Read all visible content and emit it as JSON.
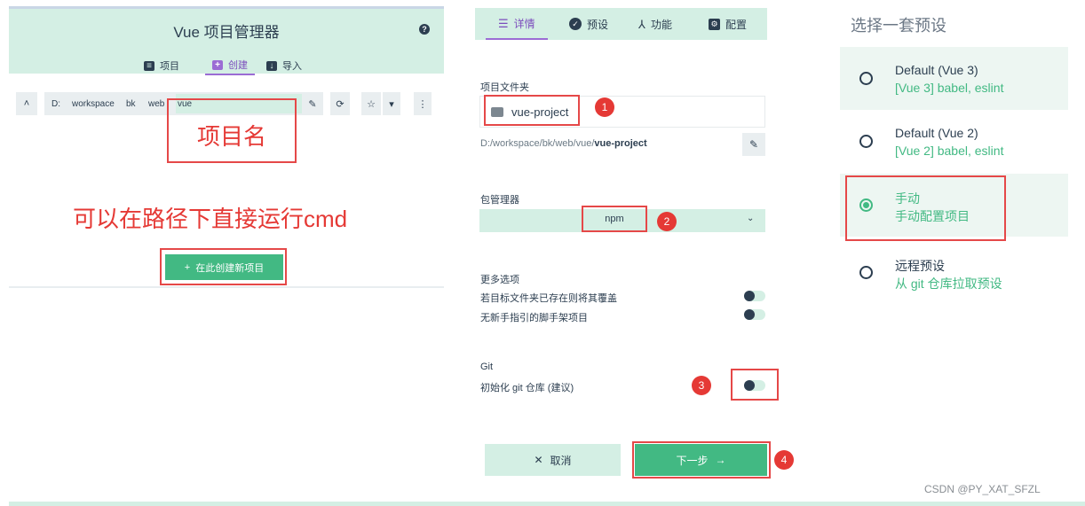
{
  "left": {
    "title": "Vue 项目管理器",
    "help_icon": "?",
    "tabs": [
      {
        "label": "项目",
        "icon": "list-icon"
      },
      {
        "label": "创建",
        "icon": "plus-icon",
        "active": true
      },
      {
        "label": "导入",
        "icon": "import-icon"
      }
    ],
    "path_bar": {
      "up_symbol": "˄",
      "crumbs": [
        "D:",
        "workspace",
        "bk",
        "web"
      ],
      "current_value": "vue",
      "edit_symbol": "✎",
      "refresh_symbol": "⟳",
      "star_symbol": "☆",
      "dropdown_symbol": "▾",
      "more_symbol": "⋮"
    },
    "annotations": {
      "project_name": "项目名",
      "cmd_note": "可以在路径下直接运行cmd"
    },
    "create_button": {
      "icon": "+",
      "label": "在此创建新项目"
    }
  },
  "middle": {
    "tabs": [
      {
        "label": "详情",
        "icon": "details-icon",
        "active": true
      },
      {
        "label": "预设",
        "icon": "check-circle-icon"
      },
      {
        "label": "功能",
        "icon": "fork-icon"
      },
      {
        "label": "配置",
        "icon": "config-icon"
      }
    ],
    "folder": {
      "label": "项目文件夹",
      "value": "vue-project",
      "path_prefix": "D:/workspace/bk/web/vue/",
      "path_name": "vue-project",
      "edit_symbol": "✎"
    },
    "package_manager": {
      "label": "包管理器",
      "value": "npm",
      "caret": "⌄"
    },
    "more_options": {
      "label": "更多选项",
      "items": [
        {
          "label": "若目标文件夹已存在则将其覆盖",
          "on": false
        },
        {
          "label": "无新手指引的脚手架项目",
          "on": false
        }
      ]
    },
    "git": {
      "label": "Git",
      "option": "初始化 git 仓库 (建议)",
      "on": false
    },
    "badges": [
      "1",
      "2",
      "3",
      "4"
    ],
    "cancel_button": {
      "icon": "✕",
      "label": "取消"
    },
    "next_button": {
      "label": "下一步",
      "icon": "→"
    }
  },
  "right": {
    "heading": "选择一套预设",
    "presets": [
      {
        "name": "Default (Vue 3)",
        "desc": "[Vue 3] babel, eslint",
        "checked": false
      },
      {
        "name": "Default (Vue 2)",
        "desc": "[Vue 2] babel, eslint",
        "checked": false
      },
      {
        "name": "手动",
        "desc": "手动配置项目",
        "checked": true
      },
      {
        "name": "远程预设",
        "desc": "从 git 仓库拉取预设",
        "checked": false
      }
    ]
  },
  "watermark": "CSDN @PY_XAT_SFZL",
  "colors": {
    "accent": "#42b983",
    "purple": "#9b6cd4",
    "annotation": "#e53935",
    "panel": "#d4efe4",
    "text": "#2c3e50"
  }
}
